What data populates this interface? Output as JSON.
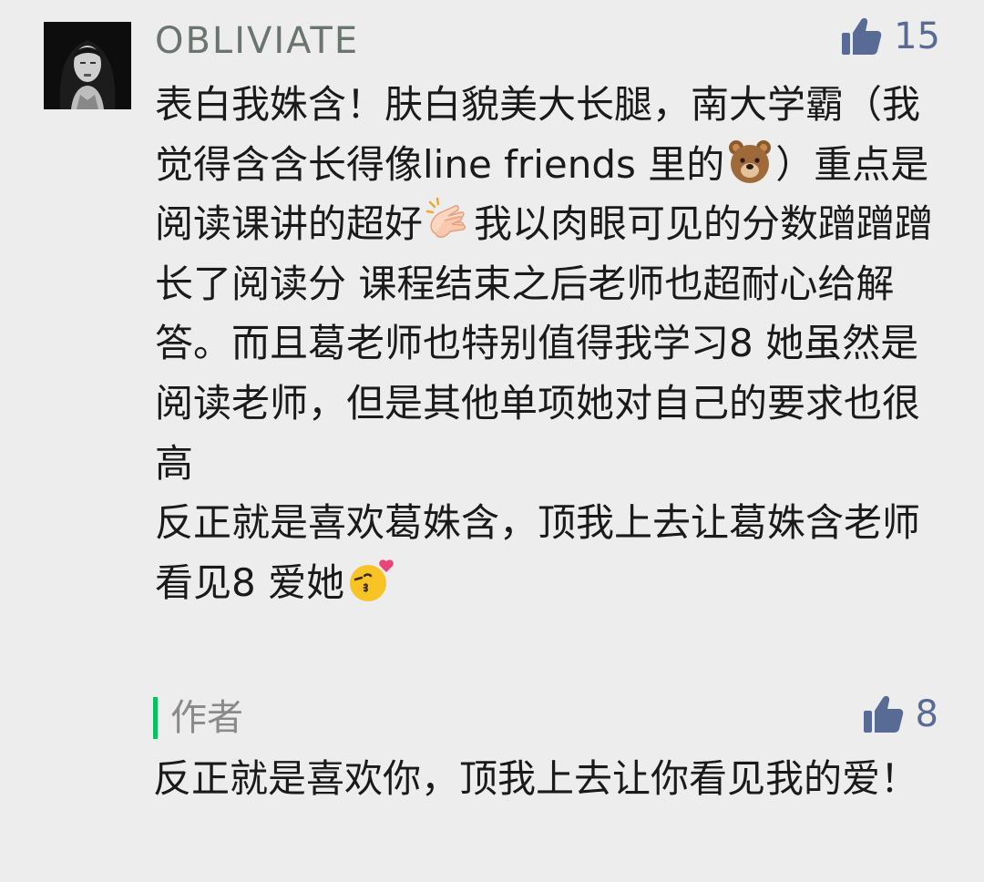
{
  "comment": {
    "username": "OBLIVIATE",
    "like_count": "15",
    "segments": [
      {
        "type": "text",
        "value": "表白我姝含！肤白貌美大长腿，南大学霸（我觉得含含长得像line friends 里的"
      },
      {
        "type": "emoji",
        "icon": "bear-face-icon"
      },
      {
        "type": "text",
        "value": "）重点是阅读课讲的超好"
      },
      {
        "type": "emoji",
        "icon": "clapping-hands-icon"
      },
      {
        "type": "text",
        "value": "我以肉眼可见的分数蹭蹭蹭长了阅读分 课程结束之后老师也超耐心给解答。而且葛老师也特别值得我学习8 她虽然是阅读老师，但是其他单项她对自己的要求也很高\n反正就是喜欢葛姝含，顶我上去让葛姝含老师看见8 爱她"
      },
      {
        "type": "emoji",
        "icon": "kiss-heart-icon"
      }
    ]
  },
  "author_reply": {
    "label": "作者",
    "like_count": "8",
    "text": "反正就是喜欢你，顶我上去让你看见我的爱！"
  },
  "colors": {
    "background": "#ededed",
    "username": "#6b7570",
    "like_blue": "#576b95",
    "author_bar": "#07c160",
    "body_text": "#1a1a1a"
  }
}
